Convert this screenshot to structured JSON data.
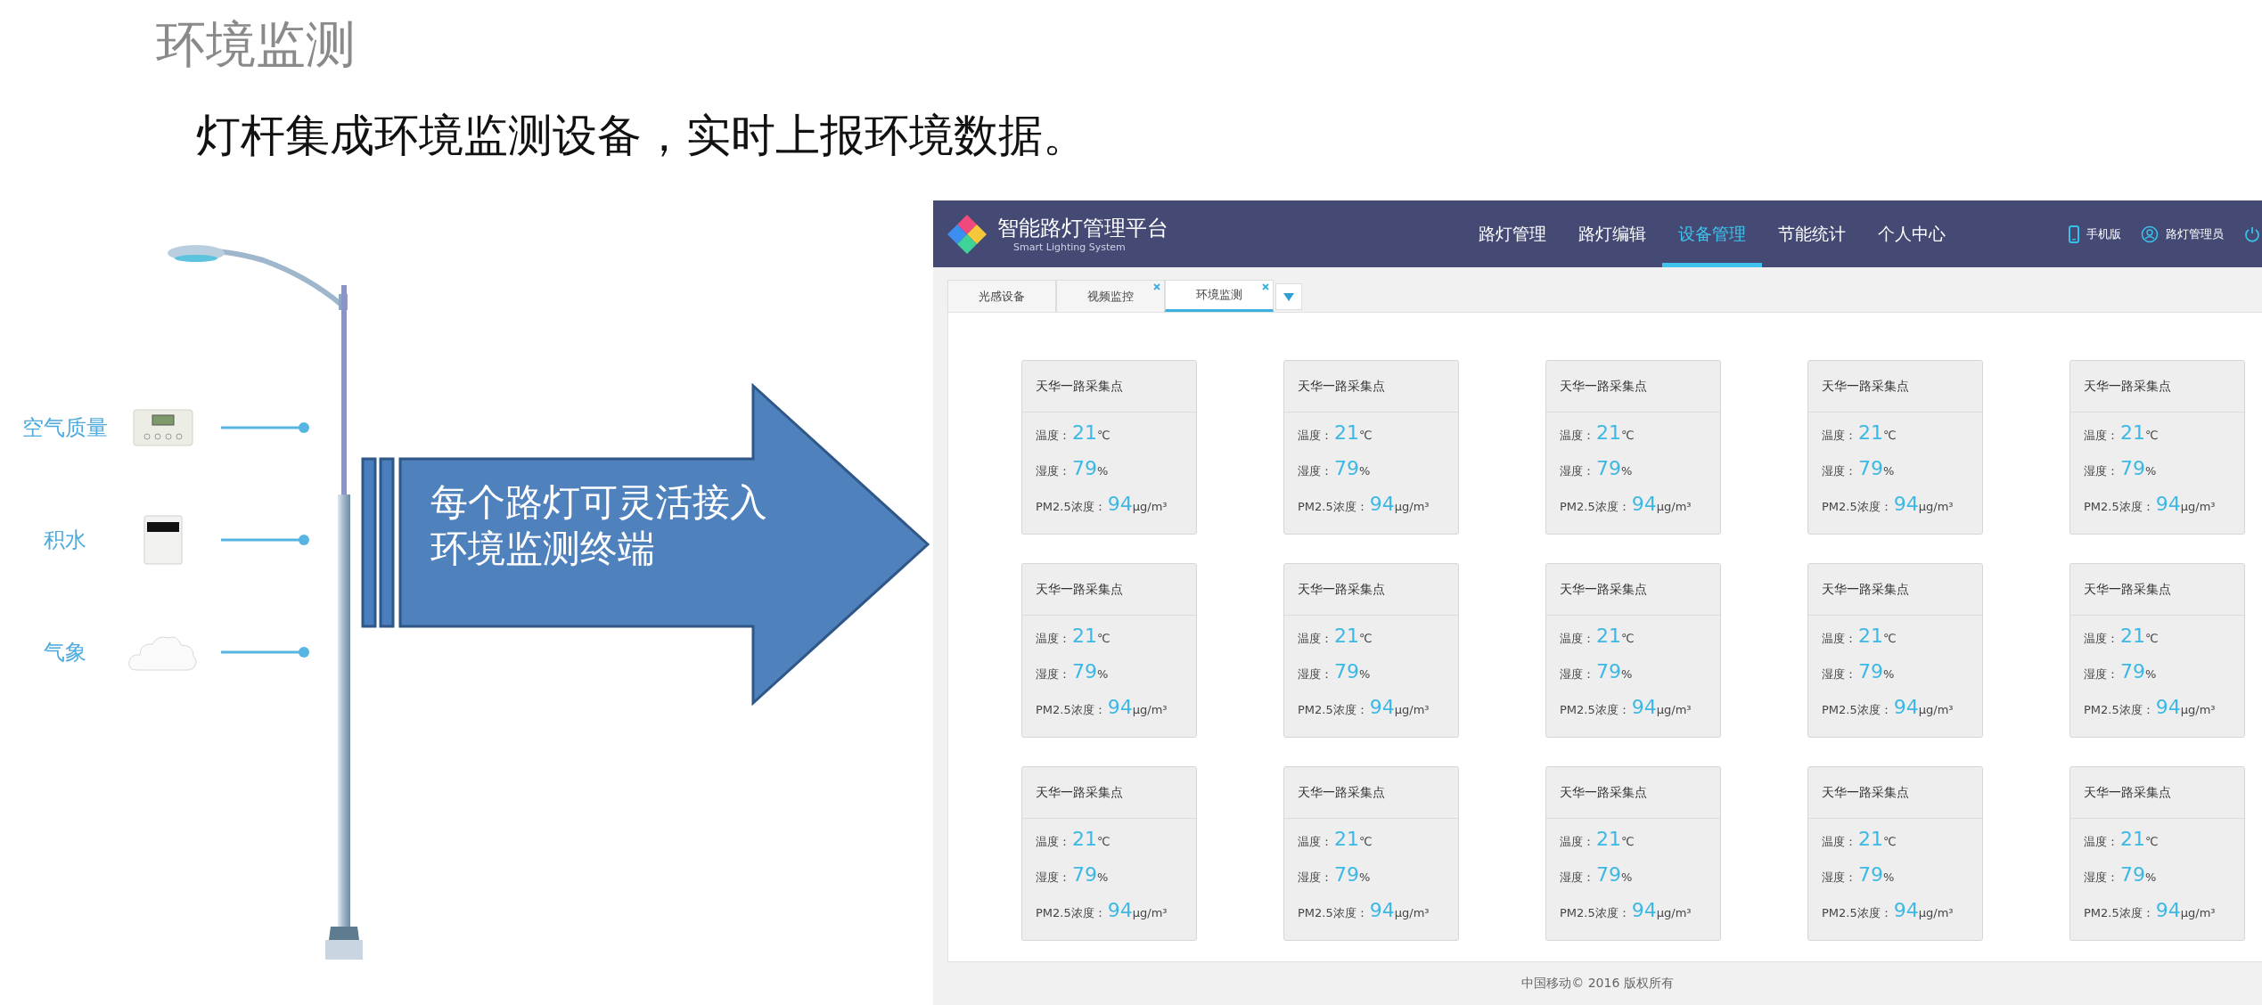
{
  "slide": {
    "title": "环境监测",
    "subtitle": "灯杆集成环境监测设备，实时上报环境数据。"
  },
  "sensors": [
    {
      "kind": "air",
      "label": "空气质量"
    },
    {
      "kind": "water",
      "label": "积水"
    },
    {
      "kind": "weather",
      "label": "气象"
    }
  ],
  "callout": {
    "text": "每个路灯可灵活接入环境监测终端"
  },
  "app": {
    "title": "智能路灯管理平台",
    "subtitle": "Smart Lighting System",
    "nav": [
      {
        "label": "路灯管理",
        "selected": false
      },
      {
        "label": "路灯编辑",
        "selected": false
      },
      {
        "label": "设备管理",
        "selected": true
      },
      {
        "label": "节能统计",
        "selected": false
      },
      {
        "label": "个人中心",
        "selected": false
      }
    ],
    "mobile_link": "手机版",
    "user": "路灯管理员",
    "tabs": [
      {
        "label": "光感设备",
        "selected": false,
        "closable": false
      },
      {
        "label": "视频监控",
        "selected": false,
        "closable": true
      },
      {
        "label": "环境监测",
        "selected": true,
        "closable": true
      }
    ],
    "cards": [
      {
        "title": "天华一路采集点",
        "readings": [
          {
            "label": "温度：",
            "value": "21",
            "unit": "℃"
          },
          {
            "label": "湿度：",
            "value": "79",
            "unit": "%"
          },
          {
            "label": "PM2.5浓度：",
            "value": "94",
            "unit": "μg/m³"
          }
        ]
      },
      {
        "title": "天华一路采集点",
        "readings": [
          {
            "label": "温度：",
            "value": "21",
            "unit": "℃"
          },
          {
            "label": "湿度：",
            "value": "79",
            "unit": "%"
          },
          {
            "label": "PM2.5浓度：",
            "value": "94",
            "unit": "μg/m³"
          }
        ]
      },
      {
        "title": "天华一路采集点",
        "readings": [
          {
            "label": "温度：",
            "value": "21",
            "unit": "℃"
          },
          {
            "label": "湿度：",
            "value": "79",
            "unit": "%"
          },
          {
            "label": "PM2.5浓度：",
            "value": "94",
            "unit": "μg/m³"
          }
        ]
      },
      {
        "title": "天华一路采集点",
        "readings": [
          {
            "label": "温度：",
            "value": "21",
            "unit": "℃"
          },
          {
            "label": "湿度：",
            "value": "79",
            "unit": "%"
          },
          {
            "label": "PM2.5浓度：",
            "value": "94",
            "unit": "μg/m³"
          }
        ]
      },
      {
        "title": "天华一路采集点",
        "readings": [
          {
            "label": "温度：",
            "value": "21",
            "unit": "℃"
          },
          {
            "label": "湿度：",
            "value": "79",
            "unit": "%"
          },
          {
            "label": "PM2.5浓度：",
            "value": "94",
            "unit": "μg/m³"
          }
        ]
      },
      {
        "title": "天华一路采集点",
        "readings": [
          {
            "label": "温度：",
            "value": "21",
            "unit": "℃"
          },
          {
            "label": "湿度：",
            "value": "79",
            "unit": "%"
          },
          {
            "label": "PM2.5浓度：",
            "value": "94",
            "unit": "μg/m³"
          }
        ]
      },
      {
        "title": "天华一路采集点",
        "readings": [
          {
            "label": "温度：",
            "value": "21",
            "unit": "℃"
          },
          {
            "label": "湿度：",
            "value": "79",
            "unit": "%"
          },
          {
            "label": "PM2.5浓度：",
            "value": "94",
            "unit": "μg/m³"
          }
        ]
      },
      {
        "title": "天华一路采集点",
        "readings": [
          {
            "label": "温度：",
            "value": "21",
            "unit": "℃"
          },
          {
            "label": "湿度：",
            "value": "79",
            "unit": "%"
          },
          {
            "label": "PM2.5浓度：",
            "value": "94",
            "unit": "μg/m³"
          }
        ]
      },
      {
        "title": "天华一路采集点",
        "readings": [
          {
            "label": "温度：",
            "value": "21",
            "unit": "℃"
          },
          {
            "label": "湿度：",
            "value": "79",
            "unit": "%"
          },
          {
            "label": "PM2.5浓度：",
            "value": "94",
            "unit": "μg/m³"
          }
        ]
      },
      {
        "title": "天华一路采集点",
        "readings": [
          {
            "label": "温度：",
            "value": "21",
            "unit": "℃"
          },
          {
            "label": "湿度：",
            "value": "79",
            "unit": "%"
          },
          {
            "label": "PM2.5浓度：",
            "value": "94",
            "unit": "μg/m³"
          }
        ]
      },
      {
        "title": "天华一路采集点",
        "readings": [
          {
            "label": "温度：",
            "value": "21",
            "unit": "℃"
          },
          {
            "label": "湿度：",
            "value": "79",
            "unit": "%"
          },
          {
            "label": "PM2.5浓度：",
            "value": "94",
            "unit": "μg/m³"
          }
        ]
      },
      {
        "title": "天华一路采集点",
        "readings": [
          {
            "label": "温度：",
            "value": "21",
            "unit": "℃"
          },
          {
            "label": "湿度：",
            "value": "79",
            "unit": "%"
          },
          {
            "label": "PM2.5浓度：",
            "value": "94",
            "unit": "μg/m³"
          }
        ]
      },
      {
        "title": "天华一路采集点",
        "readings": [
          {
            "label": "温度：",
            "value": "21",
            "unit": "℃"
          },
          {
            "label": "湿度：",
            "value": "79",
            "unit": "%"
          },
          {
            "label": "PM2.5浓度：",
            "value": "94",
            "unit": "μg/m³"
          }
        ]
      },
      {
        "title": "天华一路采集点",
        "readings": [
          {
            "label": "温度：",
            "value": "21",
            "unit": "℃"
          },
          {
            "label": "湿度：",
            "value": "79",
            "unit": "%"
          },
          {
            "label": "PM2.5浓度：",
            "value": "94",
            "unit": "μg/m³"
          }
        ]
      },
      {
        "title": "天华一路采集点",
        "readings": [
          {
            "label": "温度：",
            "value": "21",
            "unit": "℃"
          },
          {
            "label": "湿度：",
            "value": "79",
            "unit": "%"
          },
          {
            "label": "PM2.5浓度：",
            "value": "94",
            "unit": "μg/m³"
          }
        ]
      }
    ],
    "footer": "中国移动© 2016 版权所有"
  }
}
